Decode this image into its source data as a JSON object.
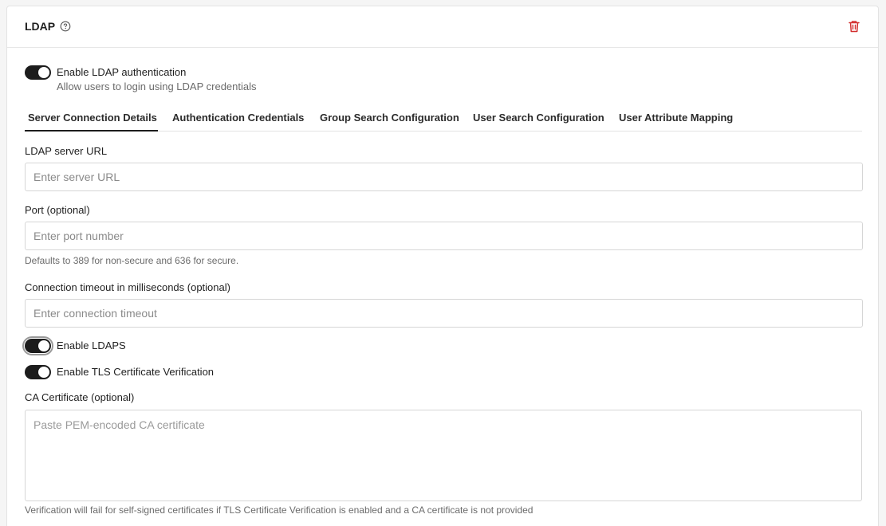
{
  "header": {
    "title": "LDAP",
    "help_icon": "question-circle-icon",
    "delete_icon": "trash-icon",
    "delete_color": "#d32f2f"
  },
  "enable_ldap": {
    "label": "Enable LDAP authentication",
    "description": "Allow users to login using LDAP credentials",
    "enabled": true
  },
  "tabs": [
    {
      "label": "Server Connection Details",
      "active": true
    },
    {
      "label": "Authentication Credentials",
      "active": false
    },
    {
      "label": "Group Search Configuration",
      "active": false
    },
    {
      "label": "User Search Configuration",
      "active": false
    },
    {
      "label": "User Attribute Mapping",
      "active": false
    }
  ],
  "form": {
    "server_url": {
      "label": "LDAP server URL",
      "placeholder": "Enter server URL",
      "value": ""
    },
    "port": {
      "label": "Port (optional)",
      "placeholder": "Enter port number",
      "value": "",
      "help": "Defaults to 389 for non-secure and 636 for secure."
    },
    "timeout": {
      "label": "Connection timeout in milliseconds (optional)",
      "placeholder": "Enter connection timeout",
      "value": ""
    },
    "ldaps": {
      "label": "Enable LDAPS",
      "enabled": true
    },
    "tls_verify": {
      "label": "Enable TLS Certificate Verification",
      "enabled": true
    },
    "ca_cert": {
      "label": "CA Certificate (optional)",
      "placeholder": "Paste PEM-encoded CA certificate",
      "value": "",
      "help": "Verification will fail for self-signed certificates if TLS Certificate Verification is enabled and a CA certificate is not provided"
    }
  },
  "colors": {
    "toggle_on": "#1c1c1c",
    "card_bg": "#ffffff",
    "page_bg": "#f5f5f5"
  }
}
